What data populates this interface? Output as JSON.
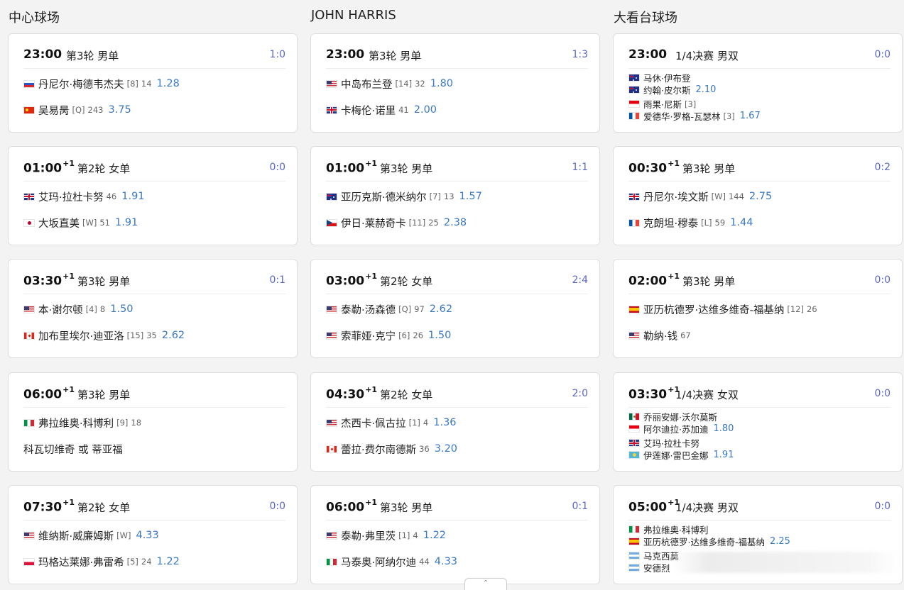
{
  "courts": [
    {
      "title": "中心球场",
      "matches": [
        {
          "time": "23:00",
          "plus": "",
          "round": "第3轮 男单",
          "score": "1:0",
          "players": [
            {
              "flag": "ru",
              "name": "丹尼尔·梅德韦杰夫",
              "seed": "[8]",
              "rank": "14",
              "odds": "1.28"
            },
            {
              "flag": "cn",
              "name": "吴易昺",
              "seed": "[Q]",
              "rank": "243",
              "odds": "3.75"
            }
          ]
        },
        {
          "time": "01:00",
          "plus": "+1",
          "round": "第2轮 女单",
          "score": "0:0",
          "players": [
            {
              "flag": "gb",
              "name": "艾玛·拉杜卡努",
              "seed": "",
              "rank": "46",
              "odds": "1.91"
            },
            {
              "flag": "jp",
              "name": "大坂直美",
              "seed": "[W]",
              "rank": "51",
              "odds": "1.91"
            }
          ]
        },
        {
          "time": "03:30",
          "plus": "+1",
          "round": "第3轮 男单",
          "score": "0:1",
          "players": [
            {
              "flag": "us",
              "name": "本·谢尔顿",
              "seed": "[4]",
              "rank": "8",
              "odds": "1.50"
            },
            {
              "flag": "ca",
              "name": "加布里埃尔·迪亚洛",
              "seed": "[15]",
              "rank": "35",
              "odds": "2.62"
            }
          ]
        },
        {
          "time": "06:00",
          "plus": "+1",
          "round": "第3轮 男单",
          "score": "",
          "players": [
            {
              "flag": "it",
              "name": "弗拉维奥·科博利",
              "seed": "[9]",
              "rank": "18",
              "odds": ""
            },
            {
              "flag": "",
              "name": "科瓦切维奇 或 蒂亚福",
              "seed": "",
              "rank": "",
              "odds": ""
            }
          ]
        },
        {
          "time": "07:30",
          "plus": "+1",
          "round": "第2轮 女单",
          "score": "0:0",
          "players": [
            {
              "flag": "us",
              "name": "维纳斯·威廉姆斯",
              "seed": "[W]",
              "rank": "",
              "odds": "4.33"
            },
            {
              "flag": "pl",
              "name": "玛格达莱娜·弗雷希",
              "seed": "[5]",
              "rank": "24",
              "odds": "1.22"
            }
          ]
        }
      ]
    },
    {
      "title": "JOHN HARRIS",
      "matches": [
        {
          "time": "23:00",
          "plus": "",
          "round": "第3轮 男单",
          "score": "1:3",
          "players": [
            {
              "flag": "us",
              "name": "中岛布兰登",
              "seed": "[14]",
              "rank": "32",
              "odds": "1.80"
            },
            {
              "flag": "gb",
              "name": "卡梅伦·诺里",
              "seed": "",
              "rank": "41",
              "odds": "2.00"
            }
          ]
        },
        {
          "time": "01:00",
          "plus": "+1",
          "round": "第3轮 男单",
          "score": "1:1",
          "players": [
            {
              "flag": "au",
              "name": "亚历克斯·德米纳尔",
              "seed": "[7]",
              "rank": "13",
              "odds": "1.57"
            },
            {
              "flag": "cz",
              "name": "伊日·莱赫奇卡",
              "seed": "[11]",
              "rank": "25",
              "odds": "2.38"
            }
          ]
        },
        {
          "time": "03:00",
          "plus": "+1",
          "round": "第2轮 女单",
          "score": "2:4",
          "players": [
            {
              "flag": "us",
              "name": "泰勒·汤森德",
              "seed": "[Q]",
              "rank": "97",
              "odds": "2.62"
            },
            {
              "flag": "us",
              "name": "索菲娅·克宁",
              "seed": "[6]",
              "rank": "26",
              "odds": "1.50"
            }
          ]
        },
        {
          "time": "04:30",
          "plus": "+1",
          "round": "第2轮 女单",
          "score": "2:0",
          "players": [
            {
              "flag": "us",
              "name": "杰西卡·佩古拉",
              "seed": "[1]",
              "rank": "4",
              "odds": "1.36"
            },
            {
              "flag": "ca",
              "name": "蕾拉·费尔南德斯",
              "seed": "",
              "rank": "36",
              "odds": "3.20"
            }
          ]
        },
        {
          "time": "06:00",
          "plus": "+1",
          "round": "第3轮 男单",
          "score": "0:1",
          "players": [
            {
              "flag": "us",
              "name": "泰勒·弗里茨",
              "seed": "[1]",
              "rank": "4",
              "odds": "1.22"
            },
            {
              "flag": "it",
              "name": "马泰奥·阿纳尔迪",
              "seed": "",
              "rank": "44",
              "odds": "4.33"
            }
          ]
        }
      ]
    },
    {
      "title": "大看台球场",
      "matches": [
        {
          "time": "23:00",
          "plus": "",
          "round": "1/4决赛 男双",
          "score": "0:0",
          "doubles": true,
          "players": [
            {
              "flag": "au",
              "name": "马休·伊布登",
              "seed": "",
              "rank": "",
              "odds": ""
            },
            {
              "flag": "au",
              "name": "约翰·皮尔斯",
              "seed": "",
              "rank": "",
              "odds": "2.10"
            },
            {
              "flag": "id",
              "name": "雨果·尼斯",
              "seed": "[3]",
              "rank": "",
              "odds": ""
            },
            {
              "flag": "fr",
              "name": "爱德华·罗格-瓦瑟林",
              "seed": "[3]",
              "rank": "",
              "odds": "1.67"
            }
          ]
        },
        {
          "time": "00:30",
          "plus": "+1",
          "round": "第3轮 男单",
          "score": "0:2",
          "players": [
            {
              "flag": "gb",
              "name": "丹尼尔·埃文斯",
              "seed": "[W]",
              "rank": "144",
              "odds": "2.75"
            },
            {
              "flag": "fr",
              "name": "克朗坦·穆泰",
              "seed": "[L]",
              "rank": "59",
              "odds": "1.44"
            }
          ]
        },
        {
          "time": "02:00",
          "plus": "+1",
          "round": "第3轮 男单",
          "score": "0:0",
          "players": [
            {
              "flag": "es",
              "name": "亚历杭德罗·达维多维奇-福基纳",
              "seed": "[12]",
              "rank": "26",
              "odds": ""
            },
            {
              "flag": "us",
              "name": "勒纳·钱",
              "seed": "",
              "rank": "67",
              "odds": ""
            }
          ]
        },
        {
          "time": "03:30",
          "plus": "+1",
          "round": "1/4决赛 女双",
          "score": "0:0",
          "doubles": true,
          "players": [
            {
              "flag": "mx",
              "name": "乔丽安娜·沃尔莫斯",
              "seed": "",
              "rank": "",
              "odds": ""
            },
            {
              "flag": "id",
              "name": "阿尔迪拉·苏加迪",
              "seed": "",
              "rank": "",
              "odds": "1.80"
            },
            {
              "flag": "gb",
              "name": "艾玛·拉杜卡努",
              "seed": "",
              "rank": "",
              "odds": ""
            },
            {
              "flag": "kz",
              "name": "伊莲娜·雷巴金娜",
              "seed": "",
              "rank": "",
              "odds": "1.91"
            }
          ]
        },
        {
          "time": "05:00",
          "plus": "+1",
          "round": "1/4决赛 男双",
          "score": "0:0",
          "doubles": true,
          "players": [
            {
              "flag": "it",
              "name": "弗拉维奥·科博利",
              "seed": "",
              "rank": "",
              "odds": ""
            },
            {
              "flag": "es",
              "name": "亚历杭德罗·达维多维奇-福基纳",
              "seed": "",
              "rank": "",
              "odds": "2.25"
            },
            {
              "flag": "ar",
              "name": "马克西莫",
              "seed": "",
              "rank": "",
              "odds": ""
            },
            {
              "flag": "ar",
              "name": "安德烈",
              "seed": "",
              "rank": "",
              "odds": ""
            }
          ]
        }
      ]
    }
  ],
  "colors": {
    "score": "#5a67c9",
    "odds": "#3a78c4"
  }
}
